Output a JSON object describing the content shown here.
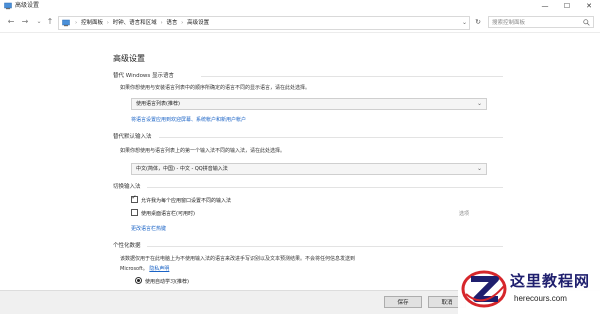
{
  "window": {
    "title": "高级设置",
    "controls": {
      "minimize": "—",
      "maximize": "☐",
      "close": "✕"
    }
  },
  "nav": {
    "back": "←",
    "forward": "→",
    "up": "↑",
    "breadcrumbs": [
      "控制面板",
      "时钟、语言和区域",
      "语言",
      "高级设置"
    ],
    "refresh": "↻",
    "search_placeholder": "搜索控制面板"
  },
  "main": {
    "page_title": "高级设置",
    "sections": {
      "display_language": {
        "heading": "替代 Windows 显示语言",
        "description": "如果你想使用与安装语言列表中的顺序所确定的语言不同的显示语言，请在此处选择。",
        "dropdown_value": "使用语言列表(推荐)",
        "link": "将语言设置应用到欢迎屏幕、系统帐户和新用户帐户"
      },
      "input_method": {
        "heading": "替代默认输入法",
        "description": "如果你想使用与语言列表上的第一个输入法不同的输入法，请在此处选择。",
        "dropdown_value": "中文(简体，中国) - 中文 - QQ拼音输入法"
      },
      "switch_input": {
        "heading": "切换输入法",
        "option1": "允许我为每个应用窗口设置不同的输入法",
        "option1_checked": true,
        "option2": "使用桌面语言栏(可用时)",
        "option2_checked": false,
        "options_link": "选项",
        "hotkey_link": "更改语言栏热键"
      },
      "personalization": {
        "heading": "个性化数据",
        "description_line1": "该数据仅用于在此电脑上为不使用输入法的语言来改进手写识别以及文本预测结果。不会将任何信息发送到",
        "description_line2_prefix": "Microsoft。",
        "privacy_link": "隐私声明",
        "radio_option": "使用自动学习(推荐)"
      }
    }
  },
  "footer": {
    "save_label": "保存",
    "cancel_label": "取消"
  },
  "watermark": {
    "title": "这里教程网",
    "url": "herecours.com"
  },
  "colors": {
    "link": "#1a63c6",
    "watermark_blue": "#1f1f6e",
    "watermark_red": "#d6262b"
  }
}
